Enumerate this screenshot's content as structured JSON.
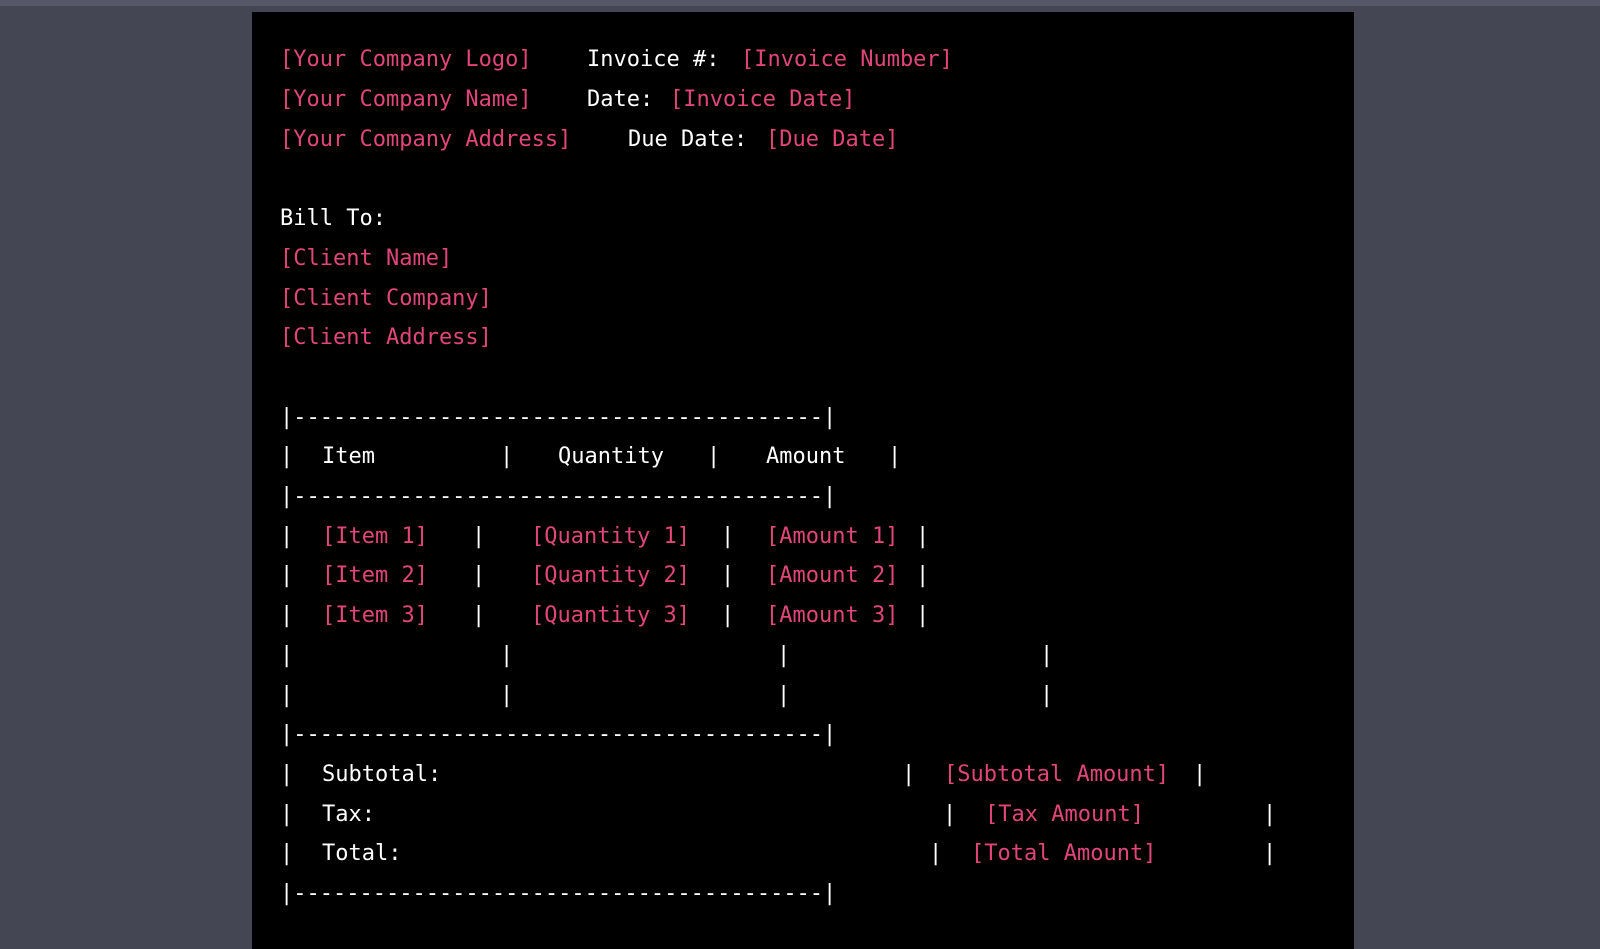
{
  "colors": {
    "page_bg": "#444654",
    "panel_bg": "#000000",
    "text": "#ffffff",
    "placeholder": "#e0457b"
  },
  "header": {
    "logo": "[Your Company Logo]",
    "company_name": "[Your Company Name]",
    "company_address": "[Your Company Address]",
    "invoice_label": "Invoice #:",
    "invoice_number": "[Invoice Number]",
    "date_label": "Date:",
    "invoice_date": "[Invoice Date]",
    "due_label": "Due Date:",
    "due_date": "[Due Date]"
  },
  "bill_to": {
    "label": "Bill To:",
    "client_name": "[Client Name]",
    "client_company": "[Client Company]",
    "client_address": "[Client Address]"
  },
  "table": {
    "rule": "|----------------------------------------|",
    "bar": "|",
    "headers": [
      "Item",
      "Quantity",
      "Amount"
    ],
    "rows": [
      [
        "[Item 1]",
        "[Quantity 1]",
        "[Amount 1]"
      ],
      [
        "[Item 2]",
        "[Quantity 2]",
        "[Amount 2]"
      ],
      [
        "[Item 3]",
        "[Quantity 3]",
        "[Amount 3]"
      ]
    ]
  },
  "totals": {
    "subtotal_label": "Subtotal:",
    "subtotal_value": "[Subtotal Amount]",
    "tax_label": "Tax:",
    "tax_value": "[Tax Amount]",
    "total_label": "Total:",
    "total_value": "[Total Amount]"
  }
}
